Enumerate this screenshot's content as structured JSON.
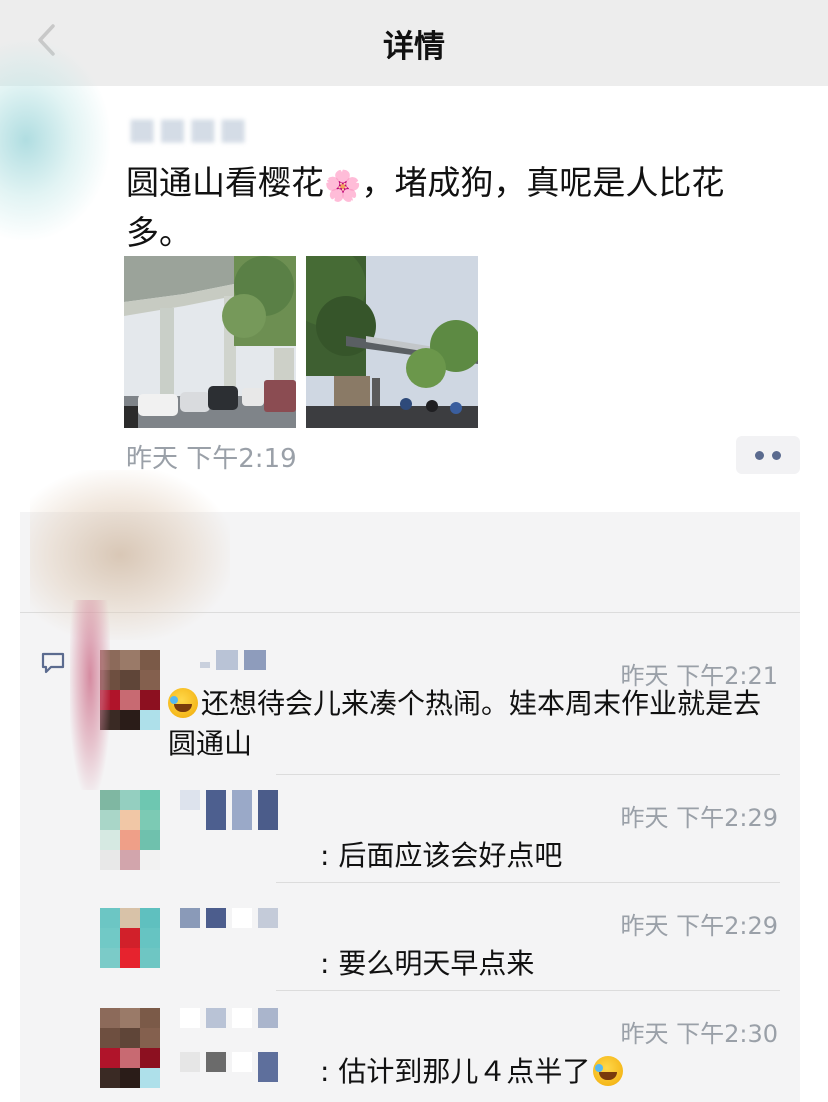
{
  "navbar": {
    "title": "详情"
  },
  "post": {
    "text_line1": "圆通山看樱花",
    "text_after_emoji": "，堵成狗，真呢是人比花",
    "text_line2": "多。",
    "time": "昨天 下午2:19"
  },
  "comments": [
    {
      "time": "昨天 下午2:21",
      "text": "还想待会儿来凑个热闹。娃本周末作业就是去圆通山",
      "emoji_prefix": "cry-laugh-emoji"
    },
    {
      "time": "昨天 下午2:29",
      "text": ": 后面应该会好点吧"
    },
    {
      "time": "昨天 下午2:29",
      "text": ": 要么明天早点来"
    },
    {
      "time": "昨天 下午2:30",
      "text": ": 估计到那儿４点半了",
      "emoji_suffix": "cry-laugh-emoji"
    }
  ],
  "icons": {
    "back": "chevron-left-icon",
    "more": "more-dots-icon",
    "comment": "comment-bubble-icon"
  },
  "colors": {
    "navbar_bg": "#ededed",
    "comments_bg": "#f4f4f5",
    "meta_text": "#9aa0a8",
    "accent_dots": "#5b6b8f"
  }
}
